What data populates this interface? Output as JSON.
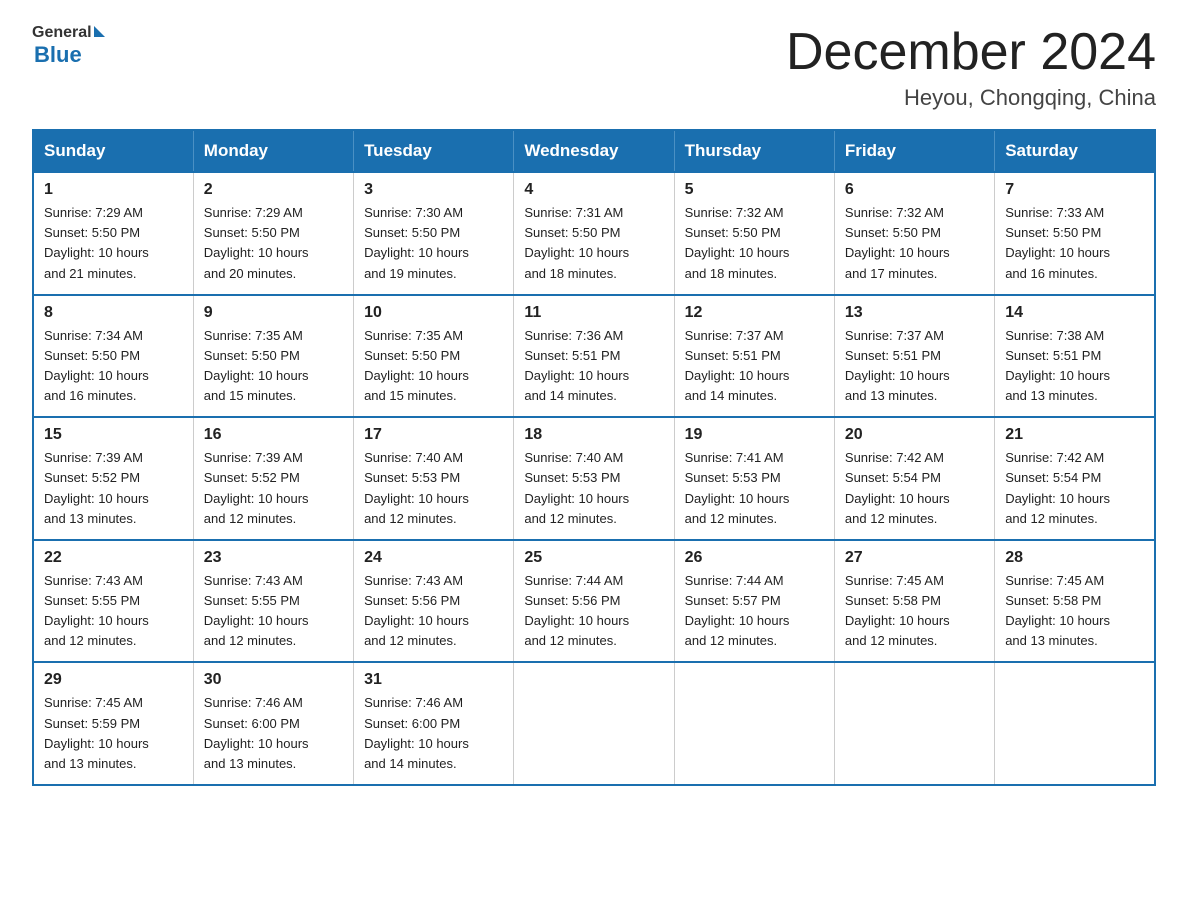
{
  "header": {
    "logo_general": "General",
    "logo_blue": "Blue",
    "month_title": "December 2024",
    "location": "Heyou, Chongqing, China"
  },
  "days_of_week": [
    "Sunday",
    "Monday",
    "Tuesday",
    "Wednesday",
    "Thursday",
    "Friday",
    "Saturday"
  ],
  "weeks": [
    [
      {
        "num": "1",
        "sunrise": "7:29 AM",
        "sunset": "5:50 PM",
        "daylight": "10 hours and 21 minutes."
      },
      {
        "num": "2",
        "sunrise": "7:29 AM",
        "sunset": "5:50 PM",
        "daylight": "10 hours and 20 minutes."
      },
      {
        "num": "3",
        "sunrise": "7:30 AM",
        "sunset": "5:50 PM",
        "daylight": "10 hours and 19 minutes."
      },
      {
        "num": "4",
        "sunrise": "7:31 AM",
        "sunset": "5:50 PM",
        "daylight": "10 hours and 18 minutes."
      },
      {
        "num": "5",
        "sunrise": "7:32 AM",
        "sunset": "5:50 PM",
        "daylight": "10 hours and 18 minutes."
      },
      {
        "num": "6",
        "sunrise": "7:32 AM",
        "sunset": "5:50 PM",
        "daylight": "10 hours and 17 minutes."
      },
      {
        "num": "7",
        "sunrise": "7:33 AM",
        "sunset": "5:50 PM",
        "daylight": "10 hours and 16 minutes."
      }
    ],
    [
      {
        "num": "8",
        "sunrise": "7:34 AM",
        "sunset": "5:50 PM",
        "daylight": "10 hours and 16 minutes."
      },
      {
        "num": "9",
        "sunrise": "7:35 AM",
        "sunset": "5:50 PM",
        "daylight": "10 hours and 15 minutes."
      },
      {
        "num": "10",
        "sunrise": "7:35 AM",
        "sunset": "5:50 PM",
        "daylight": "10 hours and 15 minutes."
      },
      {
        "num": "11",
        "sunrise": "7:36 AM",
        "sunset": "5:51 PM",
        "daylight": "10 hours and 14 minutes."
      },
      {
        "num": "12",
        "sunrise": "7:37 AM",
        "sunset": "5:51 PM",
        "daylight": "10 hours and 14 minutes."
      },
      {
        "num": "13",
        "sunrise": "7:37 AM",
        "sunset": "5:51 PM",
        "daylight": "10 hours and 13 minutes."
      },
      {
        "num": "14",
        "sunrise": "7:38 AM",
        "sunset": "5:51 PM",
        "daylight": "10 hours and 13 minutes."
      }
    ],
    [
      {
        "num": "15",
        "sunrise": "7:39 AM",
        "sunset": "5:52 PM",
        "daylight": "10 hours and 13 minutes."
      },
      {
        "num": "16",
        "sunrise": "7:39 AM",
        "sunset": "5:52 PM",
        "daylight": "10 hours and 12 minutes."
      },
      {
        "num": "17",
        "sunrise": "7:40 AM",
        "sunset": "5:53 PM",
        "daylight": "10 hours and 12 minutes."
      },
      {
        "num": "18",
        "sunrise": "7:40 AM",
        "sunset": "5:53 PM",
        "daylight": "10 hours and 12 minutes."
      },
      {
        "num": "19",
        "sunrise": "7:41 AM",
        "sunset": "5:53 PM",
        "daylight": "10 hours and 12 minutes."
      },
      {
        "num": "20",
        "sunrise": "7:42 AM",
        "sunset": "5:54 PM",
        "daylight": "10 hours and 12 minutes."
      },
      {
        "num": "21",
        "sunrise": "7:42 AM",
        "sunset": "5:54 PM",
        "daylight": "10 hours and 12 minutes."
      }
    ],
    [
      {
        "num": "22",
        "sunrise": "7:43 AM",
        "sunset": "5:55 PM",
        "daylight": "10 hours and 12 minutes."
      },
      {
        "num": "23",
        "sunrise": "7:43 AM",
        "sunset": "5:55 PM",
        "daylight": "10 hours and 12 minutes."
      },
      {
        "num": "24",
        "sunrise": "7:43 AM",
        "sunset": "5:56 PM",
        "daylight": "10 hours and 12 minutes."
      },
      {
        "num": "25",
        "sunrise": "7:44 AM",
        "sunset": "5:56 PM",
        "daylight": "10 hours and 12 minutes."
      },
      {
        "num": "26",
        "sunrise": "7:44 AM",
        "sunset": "5:57 PM",
        "daylight": "10 hours and 12 minutes."
      },
      {
        "num": "27",
        "sunrise": "7:45 AM",
        "sunset": "5:58 PM",
        "daylight": "10 hours and 12 minutes."
      },
      {
        "num": "28",
        "sunrise": "7:45 AM",
        "sunset": "5:58 PM",
        "daylight": "10 hours and 13 minutes."
      }
    ],
    [
      {
        "num": "29",
        "sunrise": "7:45 AM",
        "sunset": "5:59 PM",
        "daylight": "10 hours and 13 minutes."
      },
      {
        "num": "30",
        "sunrise": "7:46 AM",
        "sunset": "6:00 PM",
        "daylight": "10 hours and 13 minutes."
      },
      {
        "num": "31",
        "sunrise": "7:46 AM",
        "sunset": "6:00 PM",
        "daylight": "10 hours and 14 minutes."
      },
      null,
      null,
      null,
      null
    ]
  ],
  "labels": {
    "sunrise": "Sunrise:",
    "sunset": "Sunset:",
    "daylight": "Daylight:"
  }
}
